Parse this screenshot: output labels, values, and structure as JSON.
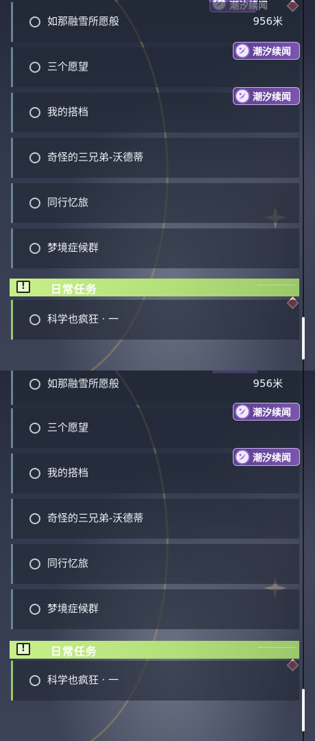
{
  "quest_list": [
    {
      "badge_text": "潮汐续闻",
      "items": [
        {
          "label": "如那融雪所愿般",
          "distance": "956米"
        },
        {
          "label": "三个愿望"
        },
        {
          "label": "我的搭档"
        },
        {
          "label": "奇怪的三兄弟-沃德蒂"
        },
        {
          "label": "同行忆旅"
        },
        {
          "label": "梦境症候群"
        }
      ],
      "section_title": "日常任务",
      "daily_item": "科学也疯狂 · 一"
    },
    {
      "badge_text": "潮汐续闻",
      "items": [
        {
          "label": "如那融雪所愿般",
          "distance": "956米"
        },
        {
          "label": "三个愿望"
        },
        {
          "label": "我的搭档"
        },
        {
          "label": "奇怪的三兄弟-沃德蒂"
        },
        {
          "label": "同行忆旅"
        },
        {
          "label": "梦境症候群"
        }
      ],
      "section_title": "日常任务",
      "daily_item": "科学也疯狂 · 一"
    }
  ],
  "icons": {
    "badge": "tide-emblem-icon",
    "section": "exclamation-box-icon",
    "marker": "red-diamond-icon"
  },
  "colors": {
    "badge_purple": "#7b56b0",
    "section_green": "#c9ef8a",
    "marker_red": "#e0475e"
  }
}
